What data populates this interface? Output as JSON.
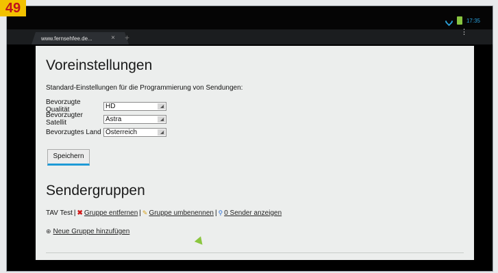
{
  "badge": "49",
  "status": {
    "time": "17:35",
    "wifi_icon": "wifi-icon",
    "battery_icon": "battery-icon"
  },
  "browser": {
    "tab_title": "www.fernsehfee.de...",
    "tab_close": "×",
    "new_tab": "+",
    "menu": "⋮"
  },
  "prefs": {
    "title": "Voreinstellungen",
    "intro": "Standard-Einstellungen für die Programmierung von Sendungen:",
    "rows": [
      {
        "label": "Bevorzugte Qualität",
        "value": "HD"
      },
      {
        "label": "Bevorzugter Satellit",
        "value": "Astra"
      },
      {
        "label": "Bevorzugtes Land",
        "value": "Österreich"
      }
    ],
    "save_label": "Speichern"
  },
  "groups": {
    "title": "Sendergruppen",
    "group_name": "TAV Test",
    "sep": "|",
    "remove_label": "Gruppe entfernen",
    "rename_label": "Gruppe umbenennen",
    "show_label": "0 Sender anzeigen",
    "add_label": "Neue Gruppe hinzufügen"
  },
  "colors": {
    "accent": "#1e9ad6",
    "badge_bg": "#f2c200",
    "badge_text": "#c0141a"
  }
}
